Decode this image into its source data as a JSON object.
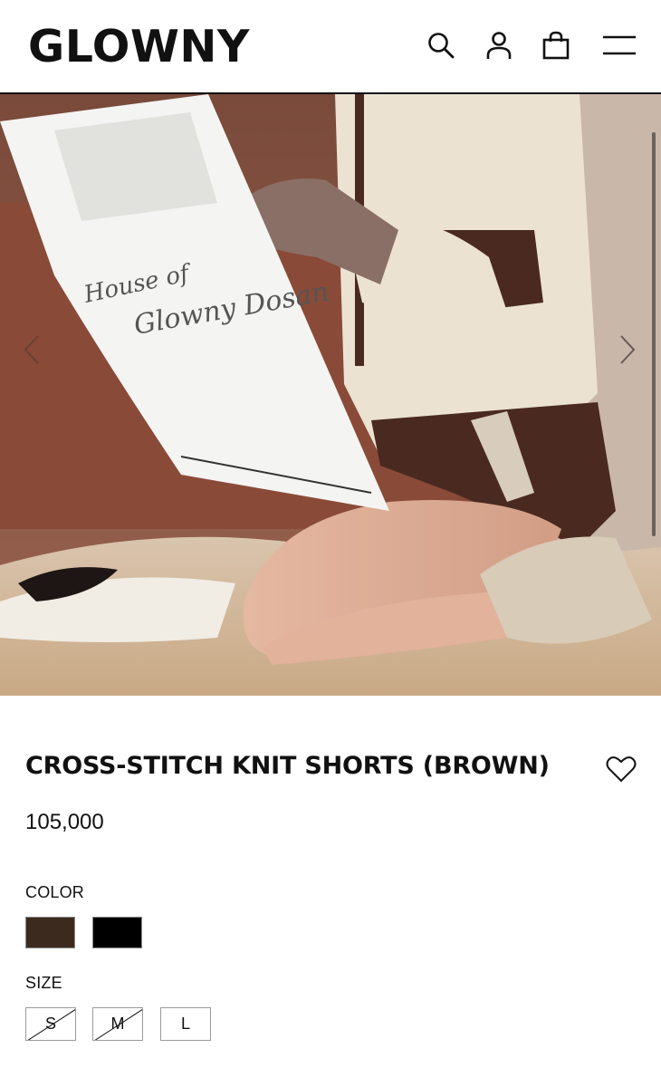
{
  "header": {
    "logo": "GLOWNY",
    "icons": [
      "search-icon",
      "user-icon",
      "shopping-bag-icon",
      "menu-icon"
    ]
  },
  "gallery": {
    "prev_icon": "chevron-left-icon",
    "next_icon": "chevron-right-icon"
  },
  "product": {
    "title": "CROSS-STITCH KNIT SHORTS (BROWN)",
    "price": "105,000",
    "wishlist_icon": "heart-icon",
    "color_label": "COLOR",
    "colors": [
      {
        "name": "brown",
        "hex": "#3d2a1f",
        "selected": true
      },
      {
        "name": "black",
        "hex": "#000000",
        "selected": false
      }
    ],
    "size_label": "SIZE",
    "sizes": [
      {
        "label": "S",
        "sold_out": true
      },
      {
        "label": "M",
        "sold_out": true
      },
      {
        "label": "L",
        "sold_out": false
      }
    ]
  },
  "colors": {
    "text": "#111111",
    "border": "#9a9a9a"
  }
}
